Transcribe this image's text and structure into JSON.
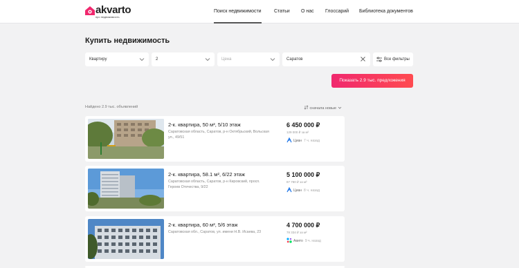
{
  "header": {
    "logo_text": "akvarto",
    "logo_tagline": "про недвижимость",
    "nav": [
      {
        "label": "Поиск недвижимости",
        "active": true
      },
      {
        "label": "Статьи",
        "active": false
      },
      {
        "label": "О нас",
        "active": false
      },
      {
        "label": "Глоссарий",
        "active": false
      },
      {
        "label": "Библиотека документов",
        "active": false
      }
    ]
  },
  "page_title": "Купить недвижимость",
  "filters": {
    "property_type": "Квартиру",
    "rooms": "2",
    "price_placeholder": "Цена",
    "city": "Саратов",
    "all_filters_label": "Все фильтры"
  },
  "show_button_label": "Показать 2.9 тыс. предложения",
  "results": {
    "found_text": "Найдено 2.9 тыс. объявлений",
    "sort_label": "сначала новые"
  },
  "listings": [
    {
      "title": "2-к. квартира, 50 м², 5/10 этаж",
      "address": "Саратовская область, Саратов, р-н Октябрьский, Вольская ул., 49/51",
      "price": "6 450 000 ₽",
      "price_per_m2": "129 000 ₽ за м²",
      "source": "Циан",
      "ago": "7 ч. назад",
      "source_icon": "cian-icon"
    },
    {
      "title": "2-к. квартира, 58.1 м², 6/22 этаж",
      "address": "Саратовская область, Саратов, р-н Кировский, просп. Героев Отечества, 9/22",
      "price": "5 100 000 ₽",
      "price_per_m2": "87 780 ₽ за м²",
      "source": "Циан",
      "ago": "8 ч. назад",
      "source_icon": "cian-icon"
    },
    {
      "title": "2-к. квартира, 60 м², 5/6 этаж",
      "address": "Саратовская обл., Саратов, ул. имени Н.В. Исаева, 23",
      "price": "4 700 000 ₽",
      "price_per_m2": "78 334 ₽ за м²",
      "source": "Авито",
      "ago": "9 ч. назад",
      "source_icon": "avito-icon"
    }
  ],
  "colors": {
    "accent_gradient_start": "#f0286e",
    "accent_gradient_end": "#ff4b50",
    "background": "#f2f2f3"
  }
}
